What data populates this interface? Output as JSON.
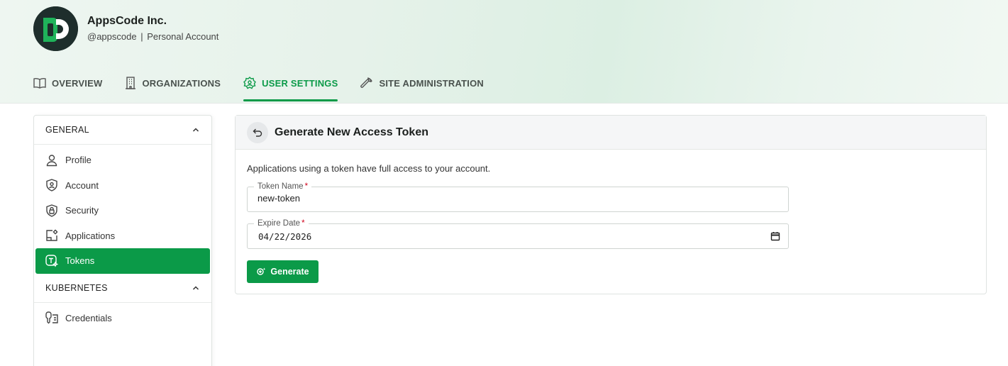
{
  "header": {
    "org_name": "AppsCode Inc.",
    "handle": "@appscode",
    "separator": "|",
    "account_type": "Personal Account"
  },
  "nav": {
    "items": [
      {
        "label": "OVERVIEW",
        "icon": "book-icon"
      },
      {
        "label": "ORGANIZATIONS",
        "icon": "building-icon"
      },
      {
        "label": "USER SETTINGS",
        "icon": "user-gear-icon",
        "active": true
      },
      {
        "label": "SITE ADMINISTRATION",
        "icon": "wrench-icon"
      }
    ]
  },
  "sidebar": {
    "general_label": "GENERAL",
    "general_items": [
      {
        "label": "Profile",
        "icon": "user-icon"
      },
      {
        "label": "Account",
        "icon": "shield-user-icon"
      },
      {
        "label": "Security",
        "icon": "shield-lock-icon"
      },
      {
        "label": "Applications",
        "icon": "app-settings-icon"
      },
      {
        "label": "Tokens",
        "icon": "token-icon",
        "active": true
      }
    ],
    "kubernetes_label": "KUBERNETES",
    "kubernetes_items": [
      {
        "label": "Credentials",
        "icon": "credentials-icon"
      }
    ]
  },
  "main": {
    "title": "Generate New Access Token",
    "description": "Applications using a token have full access to your account.",
    "token_name_label": "Token Name",
    "token_name_value": "new-token",
    "expire_date_label": "Expire Date",
    "expire_date_value": "04/22/2026",
    "required_mark": "*",
    "generate_label": "Generate"
  },
  "colors": {
    "accent": "#0b9a48",
    "required": "#d0021b"
  }
}
